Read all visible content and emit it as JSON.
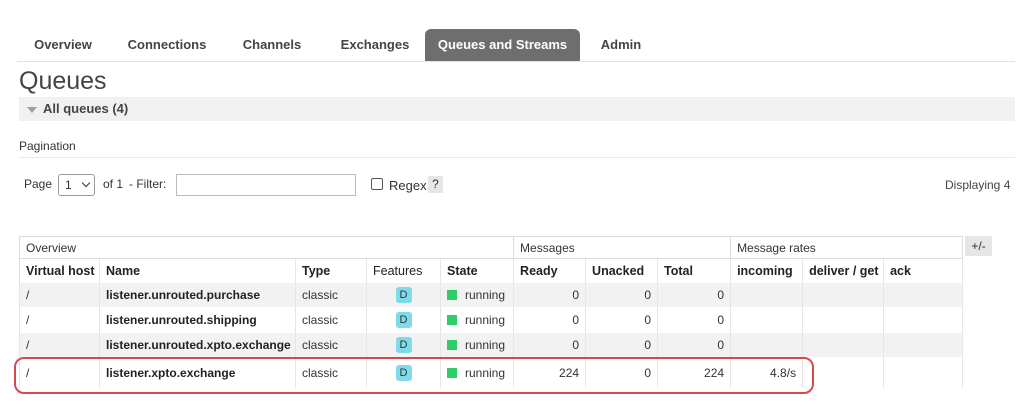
{
  "nav": {
    "tabs": [
      {
        "label": "Overview",
        "active": false
      },
      {
        "label": "Connections",
        "active": false
      },
      {
        "label": "Channels",
        "active": false
      },
      {
        "label": "Exchanges",
        "active": false
      },
      {
        "label": "Queues and Streams",
        "active": true
      },
      {
        "label": "Admin",
        "active": false
      }
    ]
  },
  "page": {
    "title": "Queues",
    "section_label": "All queues (4)"
  },
  "pagination": {
    "label": "Pagination",
    "page_label": "Page",
    "page_value": "1",
    "of_label": "of 1",
    "filter_label": "- Filter:",
    "filter_value": "",
    "regex_label": "Regex",
    "regex_checked": false,
    "help": "?",
    "displaying": "Displaying 4"
  },
  "table": {
    "groups": [
      "Overview",
      "Messages",
      "Message rates"
    ],
    "toggle": "+/-",
    "columns": [
      "Virtual host",
      "Name",
      "Type",
      "Features",
      "State",
      "Ready",
      "Unacked",
      "Total",
      "incoming",
      "deliver / get",
      "ack"
    ],
    "rows": [
      {
        "vhost": "/",
        "name": "listener.unrouted.purchase",
        "type": "classic",
        "feature": "D",
        "state": "running",
        "ready": "0",
        "unacked": "0",
        "total": "0",
        "incoming": "",
        "deliver_get": "",
        "ack": ""
      },
      {
        "vhost": "/",
        "name": "listener.unrouted.shipping",
        "type": "classic",
        "feature": "D",
        "state": "running",
        "ready": "0",
        "unacked": "0",
        "total": "0",
        "incoming": "",
        "deliver_get": "",
        "ack": ""
      },
      {
        "vhost": "/",
        "name": "listener.unrouted.xpto.exchange",
        "type": "classic",
        "feature": "D",
        "state": "running",
        "ready": "0",
        "unacked": "0",
        "total": "0",
        "incoming": "",
        "deliver_get": "",
        "ack": ""
      },
      {
        "vhost": "/",
        "name": "listener.xpto.exchange",
        "type": "classic",
        "feature": "D",
        "state": "running",
        "ready": "224",
        "unacked": "0",
        "total": "224",
        "incoming": "4.8/s",
        "deliver_get": "",
        "ack": ""
      }
    ]
  },
  "colors": {
    "active_tab": "#6e6e6e",
    "running": "#2fcc6a",
    "feature_badge": "#7fdbe9",
    "highlight": "#d84a4a"
  }
}
